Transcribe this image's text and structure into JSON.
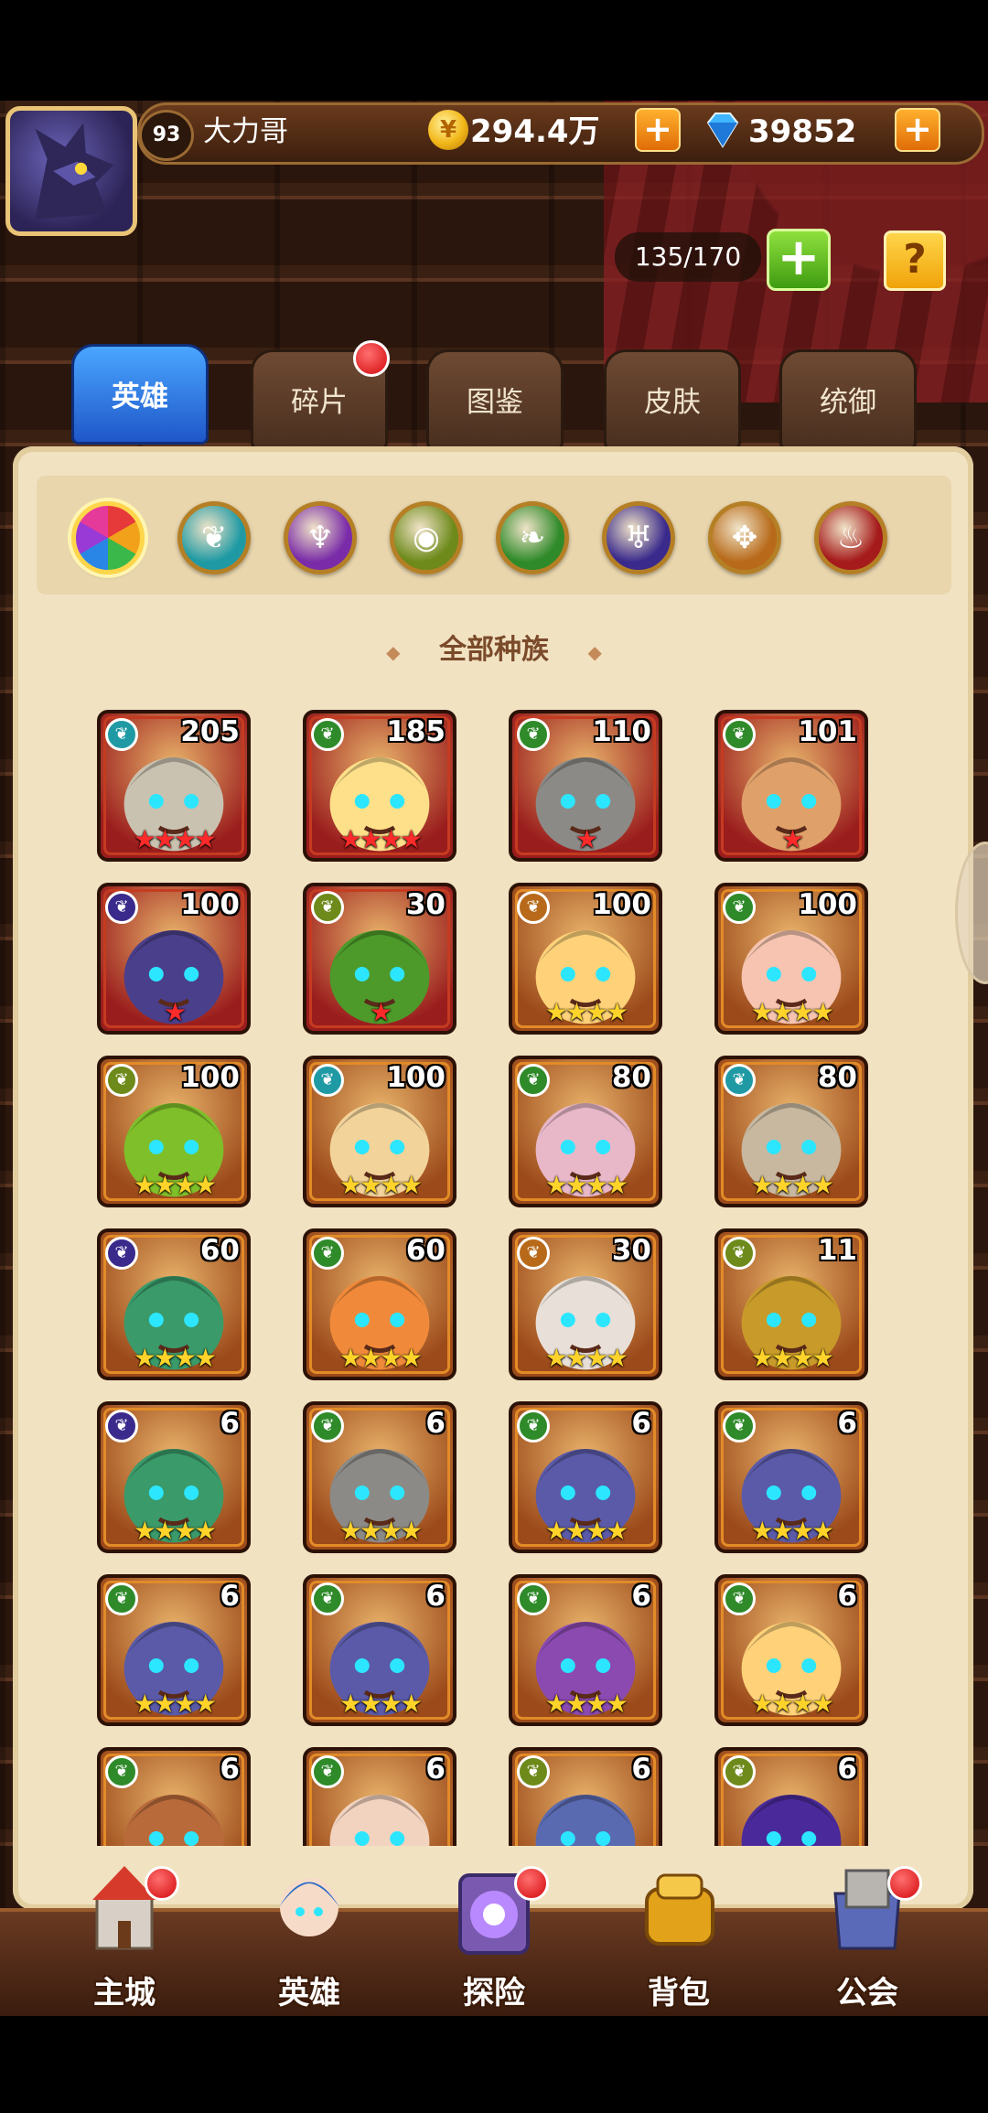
{
  "player": {
    "level": "93",
    "name": "大力哥",
    "coins": "294.4万",
    "gems": "39852",
    "hero_capacity": "135/170"
  },
  "icons": {
    "coin": "coin-icon",
    "gem": "gem-icon",
    "plus": "+",
    "help": "?"
  },
  "tabs": [
    {
      "label": "英雄",
      "active": true
    },
    {
      "label": "碎片",
      "badge": true
    },
    {
      "label": "图鉴"
    },
    {
      "label": "皮肤"
    },
    {
      "label": "统御"
    }
  ],
  "factions": [
    {
      "name": "all",
      "color": "#e8702a",
      "glyph": "",
      "selected": true
    },
    {
      "name": "forest-wind",
      "color": "#1f9aa4",
      "glyph": "❦"
    },
    {
      "name": "arcane",
      "color": "#7a2ca8",
      "glyph": "♆"
    },
    {
      "name": "nature-eye",
      "color": "#6d8a1a",
      "glyph": "◉"
    },
    {
      "name": "leaf",
      "color": "#2f8a2a",
      "glyph": "❧"
    },
    {
      "name": "dark",
      "color": "#3a2a8c",
      "glyph": "♅"
    },
    {
      "name": "light",
      "color": "#b86a1a",
      "glyph": "✥"
    },
    {
      "name": "demon",
      "color": "#a51a1a",
      "glyph": "♨"
    }
  ],
  "race_filter": {
    "title": "全部种族",
    "marker": "◆"
  },
  "heroes": [
    {
      "level": "205",
      "stars": "★★★★",
      "star_color": "red",
      "race_color": "#1f9aa4",
      "frame": "red",
      "bg": "#9a1d1d",
      "face": "#c9c2b0"
    },
    {
      "level": "185",
      "stars": "★★★★",
      "star_color": "red",
      "race_color": "#2f8a2a",
      "frame": "red",
      "bg": "#9a1d1d",
      "face": "#ffe08a"
    },
    {
      "level": "110",
      "stars": "★",
      "star_color": "red",
      "race_color": "#2f8a2a",
      "frame": "red",
      "bg": "#9a1d1d",
      "face": "#8c8a86"
    },
    {
      "level": "101",
      "stars": "★",
      "star_color": "red",
      "race_color": "#2f8a2a",
      "frame": "red",
      "bg": "#9a1d1d",
      "face": "#e0a06a"
    },
    {
      "level": "100",
      "stars": "★",
      "star_color": "red",
      "race_color": "#3a2a8c",
      "frame": "red",
      "bg": "#9a1d1d",
      "face": "#4a3f8a"
    },
    {
      "level": "30",
      "stars": "★",
      "star_color": "red",
      "race_color": "#6d8a1a",
      "frame": "red",
      "bg": "#9a1d1d",
      "face": "#4d9a2a"
    },
    {
      "level": "100",
      "stars": "★★★★",
      "star_color": "gold",
      "race_color": "#b86a1a",
      "frame": "orange",
      "bg": "#9c4a1a",
      "face": "#ffd27a"
    },
    {
      "level": "100",
      "stars": "★★★★",
      "star_color": "gold",
      "race_color": "#2f8a2a",
      "frame": "orange",
      "bg": "#9c4a1a",
      "face": "#f6c4b0"
    },
    {
      "level": "100",
      "stars": "★★★★",
      "star_color": "gold",
      "race_color": "#6d8a1a",
      "frame": "orange",
      "bg": "#9c4a1a",
      "face": "#7fbf2a"
    },
    {
      "level": "100",
      "stars": "★★★★",
      "star_color": "gold",
      "race_color": "#1f9aa4",
      "frame": "orange",
      "bg": "#9c4a1a",
      "face": "#f2d39a"
    },
    {
      "level": "80",
      "stars": "★★★★",
      "star_color": "gold",
      "race_color": "#2f8a2a",
      "frame": "orange",
      "bg": "#9c4a1a",
      "face": "#e8b8c8"
    },
    {
      "level": "80",
      "stars": "★★★★",
      "star_color": "gold",
      "race_color": "#1f9aa4",
      "frame": "orange",
      "bg": "#9c4a1a",
      "face": "#c8b8a0"
    },
    {
      "level": "60",
      "stars": "★★★★",
      "star_color": "gold",
      "race_color": "#3a2a8c",
      "frame": "orange",
      "bg": "#9c4a1a",
      "face": "#3a9a6a"
    },
    {
      "level": "60",
      "stars": "★★★★",
      "star_color": "gold",
      "race_color": "#2f8a2a",
      "frame": "orange",
      "bg": "#9c4a1a",
      "face": "#f08a3a"
    },
    {
      "level": "30",
      "stars": "★★★★",
      "star_color": "gold",
      "race_color": "#b86a1a",
      "frame": "orange",
      "bg": "#9c4a1a",
      "face": "#e8e0d8"
    },
    {
      "level": "11",
      "stars": "★★★★",
      "star_color": "gold",
      "race_color": "#6d8a1a",
      "frame": "orange",
      "bg": "#9c4a1a",
      "face": "#c89a2a"
    },
    {
      "level": "6",
      "stars": "★★★★",
      "star_color": "gold",
      "race_color": "#3a2a8c",
      "frame": "orange",
      "bg": "#9c4a1a",
      "face": "#3a9a6a"
    },
    {
      "level": "6",
      "stars": "★★★★",
      "star_color": "gold",
      "race_color": "#2f8a2a",
      "frame": "orange",
      "bg": "#9c4a1a",
      "face": "#8c8a86"
    },
    {
      "level": "6",
      "stars": "★★★★",
      "star_color": "gold",
      "race_color": "#2f8a2a",
      "frame": "orange",
      "bg": "#9c4a1a",
      "face": "#5a5aa8"
    },
    {
      "level": "6",
      "stars": "★★★★",
      "star_color": "gold",
      "race_color": "#2f8a2a",
      "frame": "orange",
      "bg": "#9c4a1a",
      "face": "#5a5aa8"
    },
    {
      "level": "6",
      "stars": "★★★★",
      "star_color": "gold",
      "race_color": "#2f8a2a",
      "frame": "orange",
      "bg": "#9c4a1a",
      "face": "#5a5aa8"
    },
    {
      "level": "6",
      "stars": "★★★★",
      "star_color": "gold",
      "race_color": "#2f8a2a",
      "frame": "orange",
      "bg": "#9c4a1a",
      "face": "#5a5aa8"
    },
    {
      "level": "6",
      "stars": "★★★★",
      "star_color": "gold",
      "race_color": "#2f8a2a",
      "frame": "orange",
      "bg": "#9c4a1a",
      "face": "#8a4ab0"
    },
    {
      "level": "6",
      "stars": "★★★★",
      "star_color": "gold",
      "race_color": "#2f8a2a",
      "frame": "orange",
      "bg": "#9c4a1a",
      "face": "#ffd27a"
    },
    {
      "level": "6",
      "stars": "",
      "star_color": "gold",
      "race_color": "#2f8a2a",
      "frame": "orange",
      "bg": "#9c4a1a",
      "face": "#b86a3a"
    },
    {
      "level": "6",
      "stars": "",
      "star_color": "gold",
      "race_color": "#2f8a2a",
      "frame": "orange",
      "bg": "#9c4a1a",
      "face": "#f2d3c0"
    },
    {
      "level": "6",
      "stars": "",
      "star_color": "gold",
      "race_color": "#6d8a1a",
      "frame": "orange",
      "bg": "#9c4a1a",
      "face": "#5a6ab0"
    },
    {
      "level": "6",
      "stars": "",
      "star_color": "gold",
      "race_color": "#6d8a1a",
      "frame": "orange",
      "bg": "#9c4a1a",
      "face": "#4a2a9a"
    }
  ],
  "bottom_nav": [
    {
      "label": "主城",
      "icon": "castle-icon",
      "badge": true
    },
    {
      "label": "英雄",
      "icon": "hero-icon",
      "badge": false
    },
    {
      "label": "探险",
      "icon": "portal-icon",
      "badge": true
    },
    {
      "label": "背包",
      "icon": "backpack-icon",
      "badge": false
    },
    {
      "label": "公会",
      "icon": "guild-icon",
      "badge": true
    }
  ]
}
